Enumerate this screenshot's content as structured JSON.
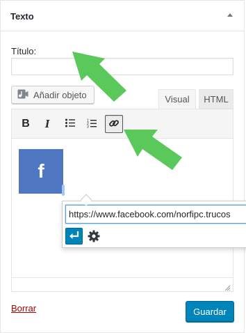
{
  "widget": {
    "title": "Texto",
    "toggle_icon": "triangle-up-icon"
  },
  "form": {
    "title_label": "Título:",
    "title_value": "",
    "add_media_label": "Añadir objeto",
    "add_media_icon": "media-music-icon"
  },
  "editor": {
    "tabs": [
      {
        "label": "Visual",
        "active": true
      },
      {
        "label": "HTML",
        "active": false
      }
    ],
    "toolbar": {
      "bold": "B",
      "italic": "I",
      "bullet_list_icon": "bullet-list-icon",
      "numbered_list_icon": "numbered-list-icon",
      "link_icon": "link-icon"
    },
    "content": {
      "image_letter": "f",
      "image_color": "#4f77c2"
    },
    "link_popup": {
      "url": "https://www.facebook.com/norfipc.trucos",
      "apply_icon": "enter-return-icon",
      "settings_icon": "gear-icon"
    }
  },
  "footer": {
    "delete_label": "Borrar",
    "save_label": "Guardar"
  },
  "colors": {
    "primary": "#0085ba",
    "danger": "#a00000",
    "annotation_arrow": "#5bc85b"
  },
  "annotations": [
    "green-arrow",
    "green-arrow"
  ]
}
